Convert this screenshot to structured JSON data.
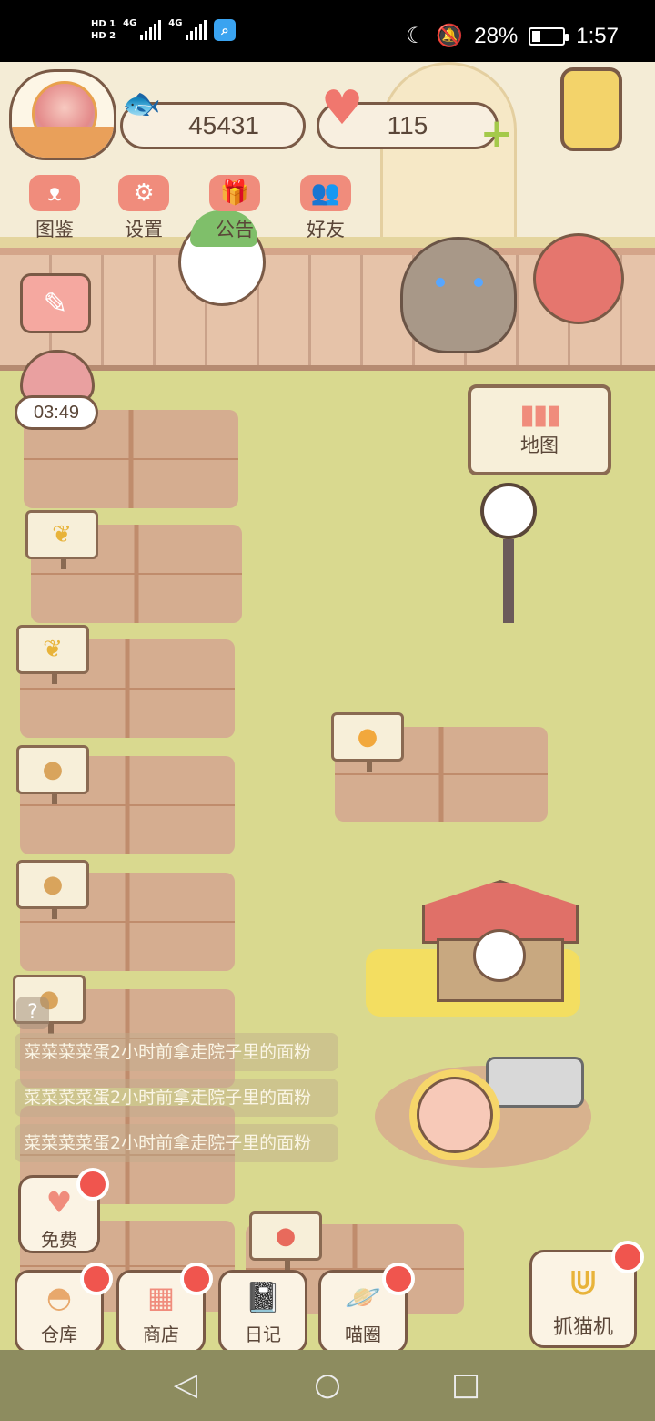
{
  "status_bar": {
    "sim1": "HD 1",
    "sim2": "HD 2",
    "net1": "4G",
    "net2": "4G",
    "battery": "28%",
    "battery_level": 0.28,
    "time": "1:57"
  },
  "resources": {
    "fish": "45431",
    "hearts": "115"
  },
  "top_menu": [
    "图鉴",
    "设置",
    "公告",
    "好友"
  ],
  "timer": "03:49",
  "map_label": "地图",
  "messages": [
    "菜菜菜菜蛋2小时前拿走院子里的面粉",
    "菜菜菜菜蛋2小时前拿走院子里的面粉",
    "菜菜菜菜蛋2小时前拿走院子里的面粉"
  ],
  "bottom_buttons": {
    "free": "免费",
    "warehouse": "仓库",
    "shop": "商店",
    "diary": "日记",
    "cat_circle": "喵圈",
    "claw": "抓猫机"
  },
  "icons": {
    "fish": "fish-icon",
    "heart": "heart-icon",
    "plus": "plus-icon"
  }
}
